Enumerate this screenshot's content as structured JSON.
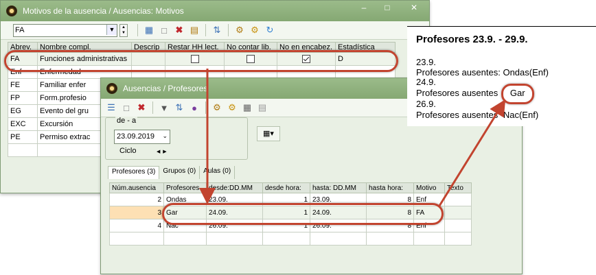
{
  "motivos_window": {
    "title": "Motivos de la ausencia / Ausencias: Motivos",
    "filter_value": "FA",
    "columns": [
      "Abrev.",
      "Nombre compl.",
      "Descrip",
      "Restar HH lect.",
      "No contar lib.",
      "No en encabez.",
      "Estadística"
    ],
    "rows": [
      {
        "abbr": "FA",
        "name": "Funciones administrativas",
        "restar": false,
        "no_contar": false,
        "no_encabez": true,
        "stat": "D"
      },
      {
        "abbr": "Enf",
        "name": "Enfermedad"
      },
      {
        "abbr": "FE",
        "name": "Familiar enfer"
      },
      {
        "abbr": "FP",
        "name": "Form.profesio"
      },
      {
        "abbr": "EG",
        "name": "Evento del gru"
      },
      {
        "abbr": "EXC",
        "name": "Excursión"
      },
      {
        "abbr": "PE",
        "name": "Permiso extrac"
      }
    ]
  },
  "ausencias_window": {
    "title": "Ausencias / Profesores",
    "range_label": "de - a",
    "date_value": "23.09.2019",
    "ciclo_label": "Ciclo",
    "tabs": [
      "Profesores (3)",
      "Grupos (0)",
      "Aulas (0)"
    ],
    "columns": [
      "Núm.ausencia",
      "Profesores",
      "desde:DD.MM",
      "desde hora:",
      "hasta: DD.MM",
      "hasta hora:",
      "Motivo",
      "Texto"
    ],
    "rows": [
      {
        "num": "2",
        "prof": "Ondas",
        "desde": "23.09.",
        "desde_hora": "1",
        "hasta": "23.09.",
        "hasta_hora": "8",
        "motivo": "Enf"
      },
      {
        "num": "3",
        "prof": "Gar",
        "desde": "24.09.",
        "desde_hora": "1",
        "hasta": "24.09.",
        "hasta_hora": "8",
        "motivo": "FA"
      },
      {
        "num": "4",
        "prof": "Nac",
        "desde": "26.09.",
        "desde_hora": "1",
        "hasta": "26.09.",
        "hasta_hora": "8",
        "motivo": "Enf"
      }
    ]
  },
  "note": {
    "header": "Profesores  23.9. - 29.9.",
    "d1": "23.9.",
    "l1": "Profesores ausentes:  Ondas(Enf)",
    "d2": "24.9.",
    "l2_prefix": "Profesores ausentes",
    "l2_value": "Gar",
    "d3": "26.9.",
    "l3_prefix": "Profesores ausentes",
    "l3_value": "Nac(Enf)"
  },
  "colors": {
    "annotation": "#c2442f",
    "titlebar": "#8fb27d"
  }
}
